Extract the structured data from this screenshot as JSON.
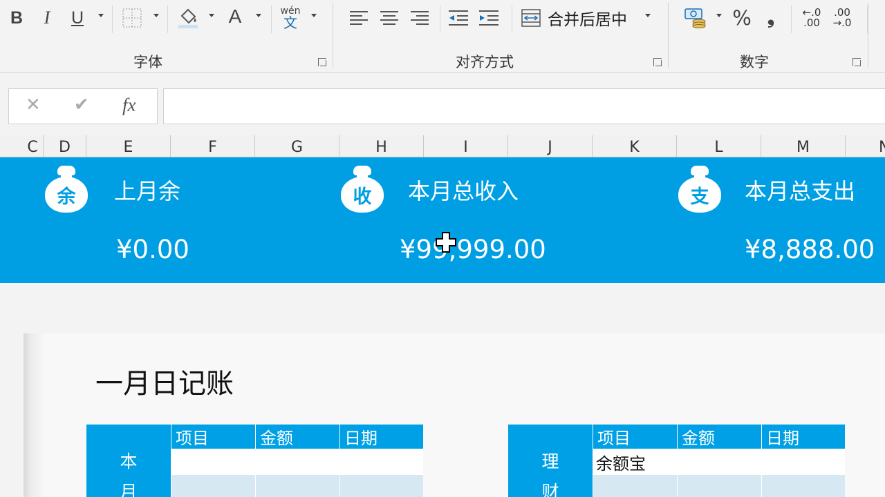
{
  "ribbon": {
    "font_group_label": "字体",
    "alignment_group_label": "对齐方式",
    "number_group_label": "数字",
    "bold": "B",
    "italic": "I",
    "underline": "U",
    "font_color_glyph": "A",
    "phonetic_top": "wén",
    "phonetic_bottom": "文",
    "merge_center_label": "合并后居中",
    "percent": "%",
    "comma": "❟",
    "inc_decimal_top": "←.0",
    "inc_decimal_bottom": ".00",
    "dec_decimal_top": ".00",
    "dec_decimal_bottom": "→.0"
  },
  "formula_bar": {
    "cancel": "✕",
    "enter": "✔",
    "fx": "fx",
    "value": ""
  },
  "columns": [
    "C",
    "D",
    "E",
    "F",
    "G",
    "H",
    "I",
    "J",
    "K",
    "L",
    "M",
    "N"
  ],
  "banner": {
    "items": [
      {
        "icon_char": "余",
        "title": "上月余",
        "amount": "¥0.00"
      },
      {
        "icon_char": "收",
        "title": "本月总收入",
        "amount": "¥99,999.00"
      },
      {
        "icon_char": "支",
        "title": "本月总支出",
        "amount": "¥8,888.00"
      }
    ],
    "color": "#009fe3"
  },
  "sheet": {
    "title": "一月日记账",
    "left_table": {
      "side_label_1": "本",
      "side_label_2": "月",
      "headers": [
        "项目",
        "金额",
        "日期"
      ],
      "rows": [
        [
          "",
          "",
          ""
        ],
        [
          "",
          "",
          ""
        ]
      ]
    },
    "right_table": {
      "side_label_1": "理",
      "side_label_2": "财",
      "headers": [
        "项目",
        "金额",
        "日期"
      ],
      "rows": [
        [
          "余额宝",
          "",
          ""
        ],
        [
          "",
          "",
          ""
        ]
      ]
    }
  }
}
